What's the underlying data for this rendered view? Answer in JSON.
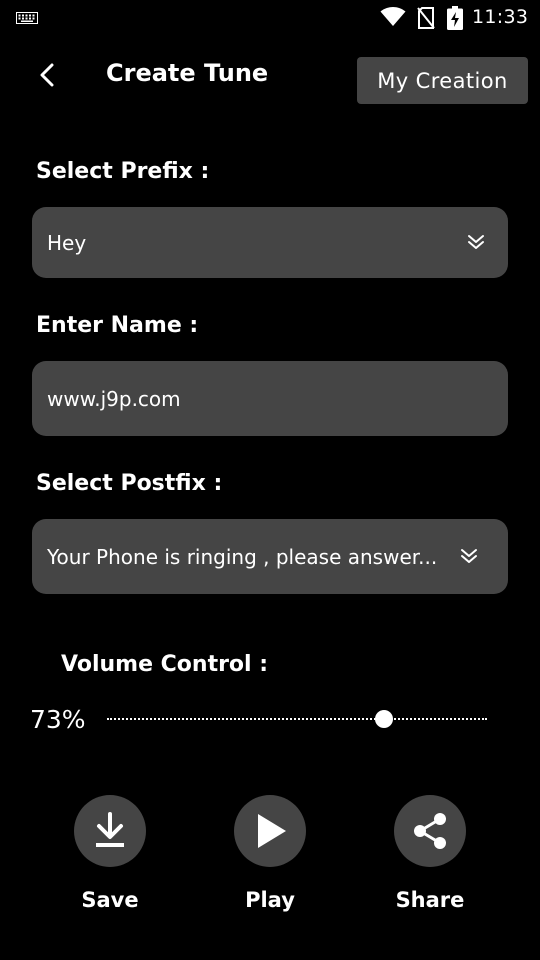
{
  "status_bar": {
    "time": "11:33",
    "icons": [
      "keyboard-icon",
      "wifi-icon",
      "no-sim-icon",
      "battery-charging-icon"
    ]
  },
  "toolbar": {
    "back_icon": "chevron-left-icon",
    "title": "Create Tune",
    "my_creation_label": "My Creation"
  },
  "prefix": {
    "label": "Select Prefix :",
    "selected": "Hey",
    "icon": "double-chevron-down-icon"
  },
  "name": {
    "label": "Enter Name :",
    "value": "www.j9p.com"
  },
  "postfix": {
    "label": "Select Postfix :",
    "selected": "Your Phone is ringing , please answer...",
    "icon": "double-chevron-down-icon"
  },
  "volume": {
    "label": "Volume Control :",
    "value_text": "73%",
    "level": 0.73
  },
  "actions": [
    {
      "label": "Save",
      "icon": "download-icon"
    },
    {
      "label": "Play",
      "icon": "play-icon"
    },
    {
      "label": "Share",
      "icon": "share-icon"
    }
  ]
}
